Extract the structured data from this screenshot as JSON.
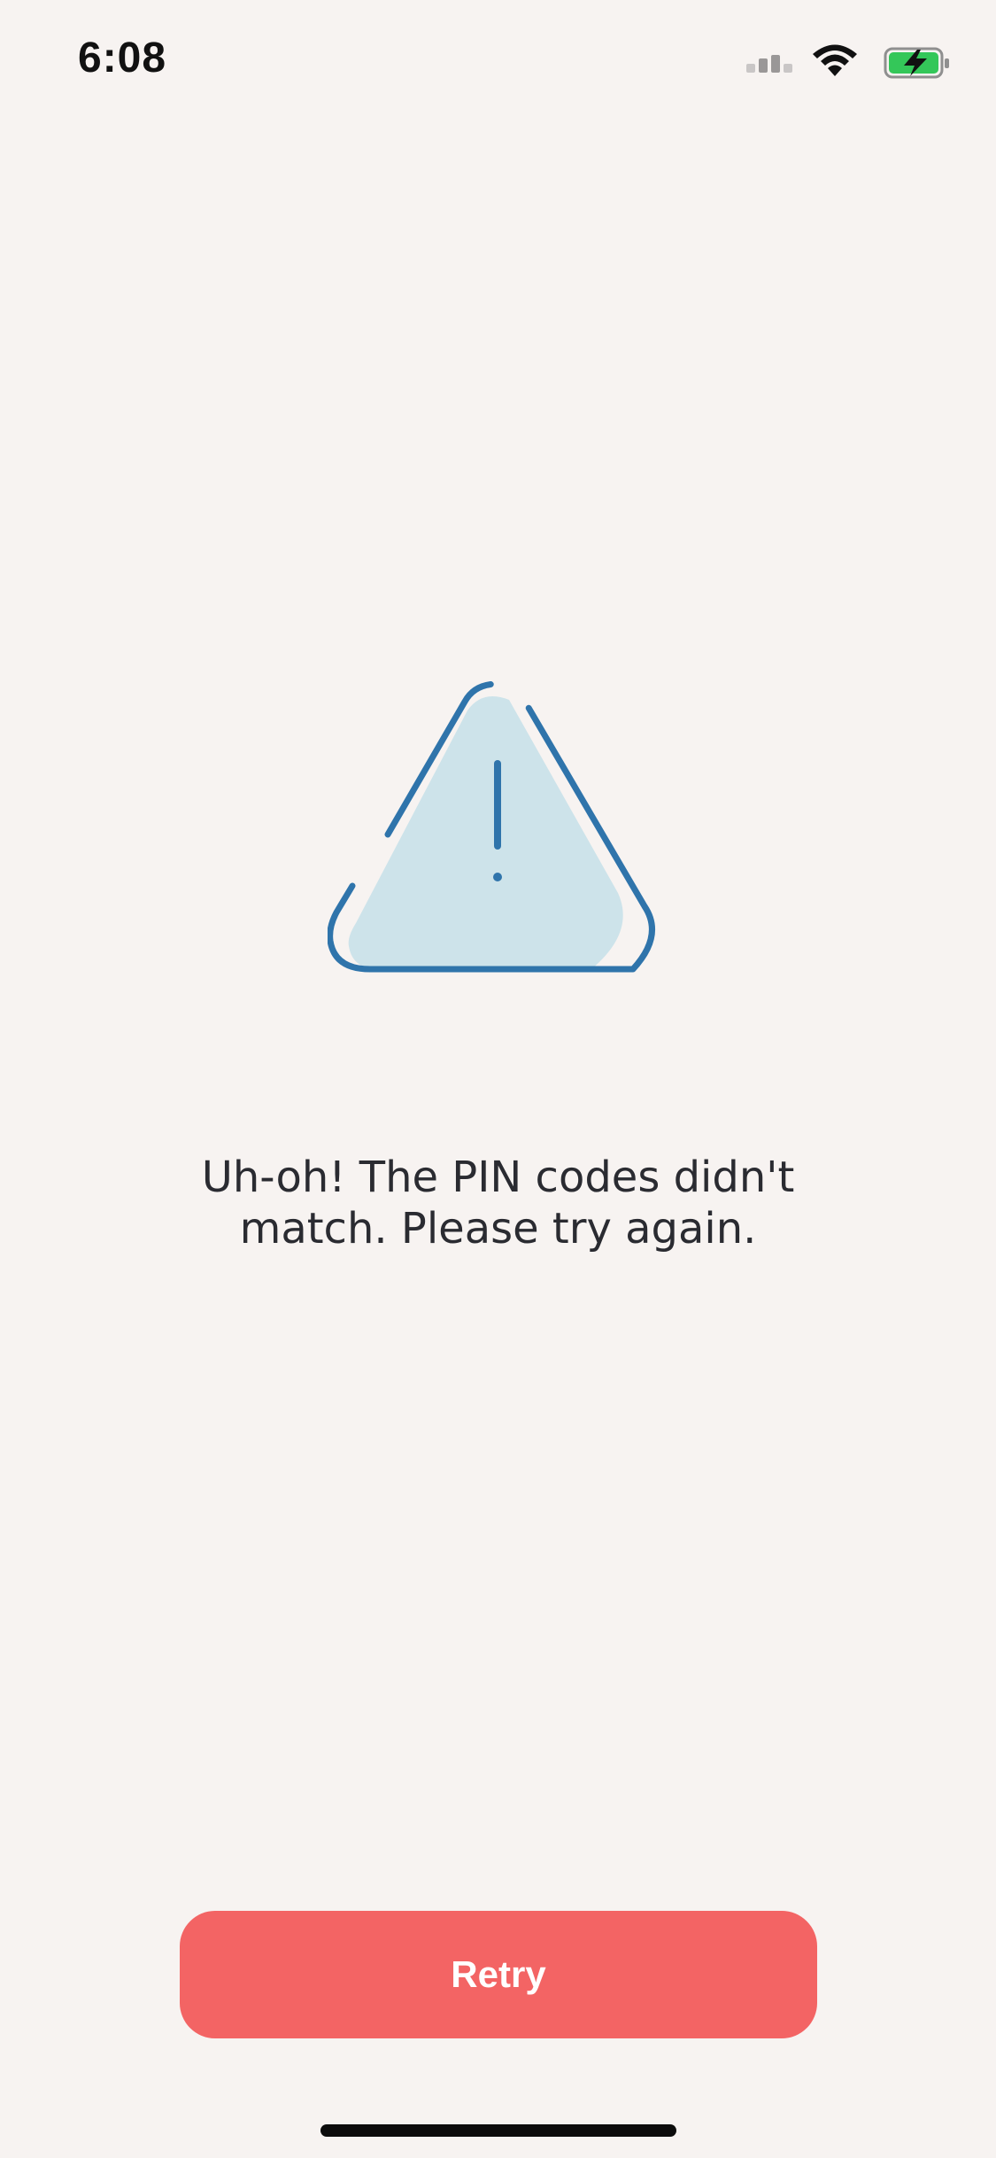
{
  "status_bar": {
    "time": "6:08",
    "icons": [
      "cellular-signal-icon",
      "wifi-icon",
      "battery-charging-icon"
    ]
  },
  "alert": {
    "icon": "warning-triangle-icon",
    "message": "Uh-oh! The PIN codes didn't match. Please try again."
  },
  "actions": {
    "retry_label": "Retry"
  },
  "colors": {
    "background": "#f7f3f1",
    "accent_blue": "#2f74ab",
    "triangle_fill": "#cde3ea",
    "retry_button": "#f36464",
    "text": "#2a2b31",
    "battery_green": "#34c759"
  }
}
